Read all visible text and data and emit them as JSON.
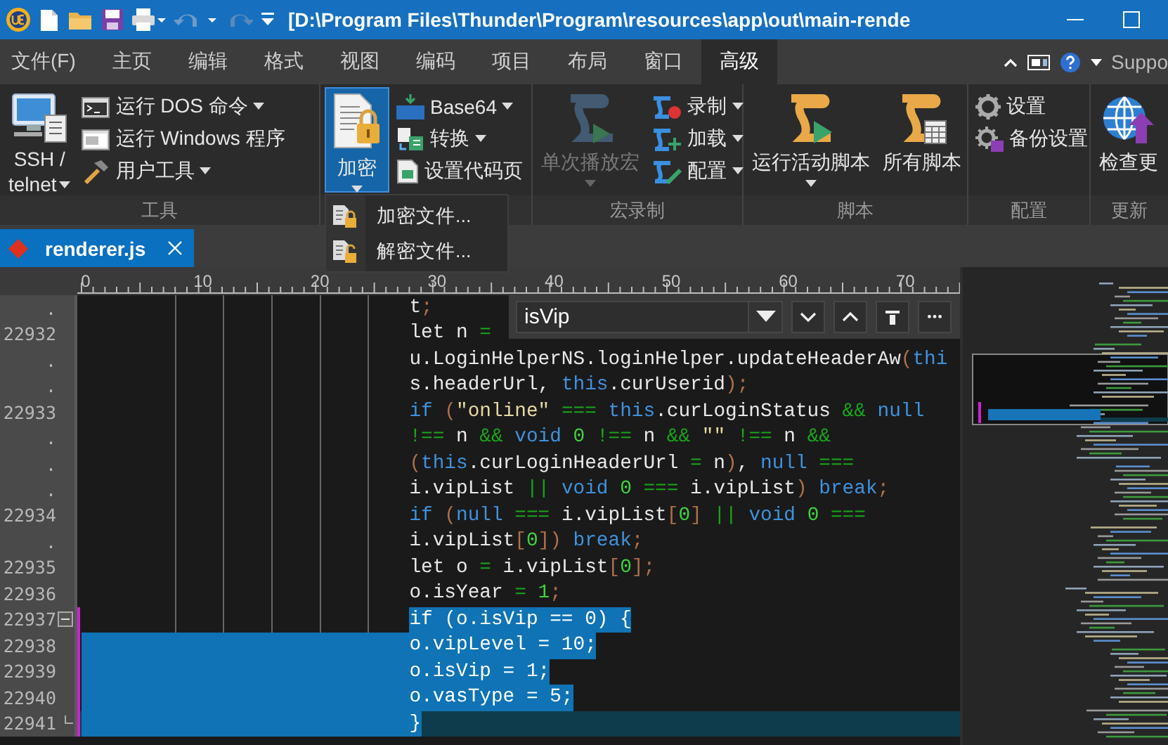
{
  "window": {
    "title": "[D:\\Program Files\\Thunder\\Program\\resources\\app\\out\\main-rende"
  },
  "menu_tabs": [
    {
      "label": "文件(F)",
      "selected": false
    },
    {
      "label": "主页",
      "selected": false
    },
    {
      "label": "编辑",
      "selected": false
    },
    {
      "label": "格式",
      "selected": false
    },
    {
      "label": "视图",
      "selected": false
    },
    {
      "label": "编码",
      "selected": false
    },
    {
      "label": "项目",
      "selected": false
    },
    {
      "label": "布局",
      "selected": false
    },
    {
      "label": "窗口",
      "selected": false
    },
    {
      "label": "高级",
      "selected": true
    }
  ],
  "help_link": "Suppo",
  "ribbon": {
    "groups": [
      {
        "label": "工具",
        "large": [
          {
            "lines": [
              "SSH /",
              "telnet"
            ],
            "caret": true,
            "selected": false,
            "disabled": false
          }
        ],
        "small": [
          {
            "label": "运行 DOS 命令",
            "caret": true
          },
          {
            "label": "运行 Windows 程序",
            "caret": false
          },
          {
            "label": "用户工具",
            "caret": true
          }
        ]
      },
      {
        "large": [
          {
            "lines": [
              "加密"
            ],
            "caret": true,
            "selected": true,
            "disabled": false
          }
        ],
        "small": [
          {
            "label": "Base64",
            "caret": true
          },
          {
            "label": "转换",
            "caret": true
          },
          {
            "label": "设置代码页",
            "caret": false
          }
        ]
      },
      {
        "label": "宏录制",
        "large": [
          {
            "lines": [
              "单次播放宏"
            ],
            "caret": true,
            "selected": false,
            "disabled": true
          }
        ],
        "small": [
          {
            "label": "录制",
            "caret": true
          },
          {
            "label": "加载",
            "caret": true
          },
          {
            "label": "配置",
            "caret": true
          }
        ]
      },
      {
        "label": "脚本",
        "large": [
          {
            "lines": [
              "运行活动脚本"
            ],
            "caret": true,
            "selected": false,
            "disabled": false
          },
          {
            "lines": [
              "所有脚本"
            ],
            "caret": false,
            "selected": false,
            "disabled": false
          }
        ]
      },
      {
        "label": "配置",
        "small": [
          {
            "label": "设置",
            "caret": false
          },
          {
            "label": "备份设置",
            "caret": false
          }
        ]
      },
      {
        "label": "更新",
        "large": [
          {
            "lines": [
              "检查更"
            ],
            "caret": false,
            "selected": false,
            "disabled": false
          }
        ]
      }
    ]
  },
  "dropdown_menu": [
    {
      "label": "加密文件..."
    },
    {
      "label": "解密文件..."
    }
  ],
  "file_tabs": [
    {
      "label": "renderer.js",
      "selected": true
    }
  ],
  "ruler": {
    "labels": [
      "0",
      "10",
      "20",
      "30",
      "40",
      "50",
      "60",
      "70"
    ]
  },
  "find_bar": {
    "value": "isVip"
  },
  "code_lines": [
    {
      "gutter": ".",
      "selected": false,
      "row_selected": false,
      "current": false,
      "modified": false,
      "fold_start": false,
      "fold_end": false,
      "tokens": [
        {
          "text": "t",
          "kind": "plain"
        },
        {
          "text": ";",
          "kind": "paren"
        }
      ]
    },
    {
      "gutter": "22932",
      "selected": false,
      "row_selected": false,
      "current": false,
      "modified": false,
      "fold_start": false,
      "fold_end": false,
      "tokens": [
        {
          "text": "let n ",
          "kind": "plain"
        },
        {
          "text": "=",
          "kind": "operator"
        }
      ]
    },
    {
      "gutter": ".",
      "selected": false,
      "row_selected": false,
      "current": false,
      "modified": false,
      "fold_start": false,
      "fold_end": false,
      "tokens": [
        {
          "text": "u.LoginHelperNS.loginHelper.updateHeaderAw",
          "kind": "plain"
        },
        {
          "text": "(",
          "kind": "paren"
        },
        {
          "text": "thi",
          "kind": "keyword"
        }
      ]
    },
    {
      "gutter": ".",
      "selected": false,
      "row_selected": false,
      "current": false,
      "modified": false,
      "fold_start": false,
      "fold_end": false,
      "tokens": [
        {
          "text": "s.headerUrl, ",
          "kind": "plain"
        },
        {
          "text": "this",
          "kind": "keyword"
        },
        {
          "text": ".curUserid",
          "kind": "plain"
        },
        {
          "text": ");",
          "kind": "paren"
        }
      ]
    },
    {
      "gutter": "22933",
      "selected": false,
      "row_selected": false,
      "current": false,
      "modified": false,
      "fold_start": false,
      "fold_end": false,
      "tokens": [
        {
          "text": "if ",
          "kind": "keyword"
        },
        {
          "text": "(",
          "kind": "paren"
        },
        {
          "text": "\"online\" ",
          "kind": "string"
        },
        {
          "text": "=== ",
          "kind": "operator"
        },
        {
          "text": "this",
          "kind": "keyword"
        },
        {
          "text": ".curLoginStatus ",
          "kind": "plain"
        },
        {
          "text": "&& ",
          "kind": "operator"
        },
        {
          "text": "null",
          "kind": "keyword"
        }
      ]
    },
    {
      "gutter": ".",
      "selected": false,
      "row_selected": false,
      "current": false,
      "modified": false,
      "fold_start": false,
      "fold_end": false,
      "tokens": [
        {
          "text": "!==",
          "kind": "operator"
        },
        {
          "text": " n ",
          "kind": "plain"
        },
        {
          "text": "&& ",
          "kind": "operator"
        },
        {
          "text": "void ",
          "kind": "keyword"
        },
        {
          "text": "0 ",
          "kind": "number"
        },
        {
          "text": "!==",
          "kind": "operator"
        },
        {
          "text": " n ",
          "kind": "plain"
        },
        {
          "text": "&& ",
          "kind": "operator"
        },
        {
          "text": "\"\" ",
          "kind": "string"
        },
        {
          "text": "!==",
          "kind": "operator"
        },
        {
          "text": " n ",
          "kind": "plain"
        },
        {
          "text": "&&",
          "kind": "operator"
        }
      ]
    },
    {
      "gutter": ".",
      "selected": false,
      "row_selected": false,
      "current": false,
      "modified": false,
      "fold_start": false,
      "fold_end": false,
      "tokens": [
        {
          "text": "(",
          "kind": "paren"
        },
        {
          "text": "this",
          "kind": "keyword"
        },
        {
          "text": ".curLoginHeaderUrl ",
          "kind": "plain"
        },
        {
          "text": "=",
          "kind": "operator"
        },
        {
          "text": " n",
          "kind": "plain"
        },
        {
          "text": ")",
          "kind": "paren"
        },
        {
          "text": ", ",
          "kind": "plain"
        },
        {
          "text": "null ",
          "kind": "keyword"
        },
        {
          "text": "===",
          "kind": "operator"
        }
      ]
    },
    {
      "gutter": ".",
      "selected": false,
      "row_selected": false,
      "current": false,
      "modified": false,
      "fold_start": false,
      "fold_end": false,
      "tokens": [
        {
          "text": "i.vipList ",
          "kind": "plain"
        },
        {
          "text": "|| ",
          "kind": "operator"
        },
        {
          "text": "void ",
          "kind": "keyword"
        },
        {
          "text": "0 ",
          "kind": "number"
        },
        {
          "text": "===",
          "kind": "operator"
        },
        {
          "text": " i.vipList",
          "kind": "plain"
        },
        {
          "text": ") ",
          "kind": "paren"
        },
        {
          "text": "break",
          "kind": "keyword"
        },
        {
          "text": ";",
          "kind": "paren"
        }
      ]
    },
    {
      "gutter": "22934",
      "selected": false,
      "row_selected": false,
      "current": false,
      "modified": false,
      "fold_start": false,
      "fold_end": false,
      "tokens": [
        {
          "text": "if ",
          "kind": "keyword"
        },
        {
          "text": "(",
          "kind": "paren"
        },
        {
          "text": "null ",
          "kind": "keyword"
        },
        {
          "text": "===",
          "kind": "operator"
        },
        {
          "text": " i.vipList",
          "kind": "plain"
        },
        {
          "text": "[",
          "kind": "paren"
        },
        {
          "text": "0",
          "kind": "number"
        },
        {
          "text": "] ",
          "kind": "paren"
        },
        {
          "text": "|| ",
          "kind": "operator"
        },
        {
          "text": "void ",
          "kind": "keyword"
        },
        {
          "text": "0 ",
          "kind": "number"
        },
        {
          "text": "===",
          "kind": "operator"
        }
      ]
    },
    {
      "gutter": ".",
      "selected": false,
      "row_selected": false,
      "current": false,
      "modified": false,
      "fold_start": false,
      "fold_end": false,
      "tokens": [
        {
          "text": "i.vipList",
          "kind": "plain"
        },
        {
          "text": "[",
          "kind": "paren"
        },
        {
          "text": "0",
          "kind": "number"
        },
        {
          "text": "]) ",
          "kind": "paren"
        },
        {
          "text": "break",
          "kind": "keyword"
        },
        {
          "text": ";",
          "kind": "paren"
        }
      ]
    },
    {
      "gutter": "22935",
      "selected": false,
      "row_selected": false,
      "current": false,
      "modified": false,
      "fold_start": false,
      "fold_end": false,
      "tokens": [
        {
          "text": "let o ",
          "kind": "plain"
        },
        {
          "text": "=",
          "kind": "operator"
        },
        {
          "text": " i.vipList",
          "kind": "plain"
        },
        {
          "text": "[",
          "kind": "paren"
        },
        {
          "text": "0",
          "kind": "number"
        },
        {
          "text": "];",
          "kind": "paren"
        }
      ]
    },
    {
      "gutter": "22936",
      "selected": false,
      "row_selected": false,
      "current": false,
      "modified": false,
      "fold_start": false,
      "fold_end": false,
      "tokens": [
        {
          "text": "o.isYear ",
          "kind": "plain"
        },
        {
          "text": "= ",
          "kind": "operator"
        },
        {
          "text": "1",
          "kind": "number"
        },
        {
          "text": ";",
          "kind": "paren"
        }
      ]
    },
    {
      "gutter": "22937",
      "selected": true,
      "row_selected": false,
      "current": false,
      "modified": true,
      "fold_start": true,
      "fold_end": false,
      "tokens": [
        {
          "text": "if (o.isVip == 0) {",
          "kind": "plain"
        }
      ]
    },
    {
      "gutter": "22938",
      "selected": true,
      "row_selected": true,
      "current": false,
      "modified": true,
      "fold_start": false,
      "fold_end": false,
      "tokens": [
        {
          "text": "o.vipLevel = 10;",
          "kind": "plain"
        }
      ]
    },
    {
      "gutter": "22939",
      "selected": true,
      "row_selected": true,
      "current": false,
      "modified": true,
      "fold_start": false,
      "fold_end": false,
      "tokens": [
        {
          "text": "o.isVip = 1;",
          "kind": "plain"
        }
      ]
    },
    {
      "gutter": "22940",
      "selected": true,
      "row_selected": true,
      "current": false,
      "modified": true,
      "fold_start": false,
      "fold_end": false,
      "tokens": [
        {
          "text": "o.vasType = 5;",
          "kind": "plain"
        }
      ]
    },
    {
      "gutter": "22941",
      "selected": true,
      "row_selected": true,
      "current": true,
      "modified": true,
      "fold_start": false,
      "fold_end": true,
      "tokens": [
        {
          "text": "}",
          "kind": "plain"
        }
      ]
    }
  ]
}
